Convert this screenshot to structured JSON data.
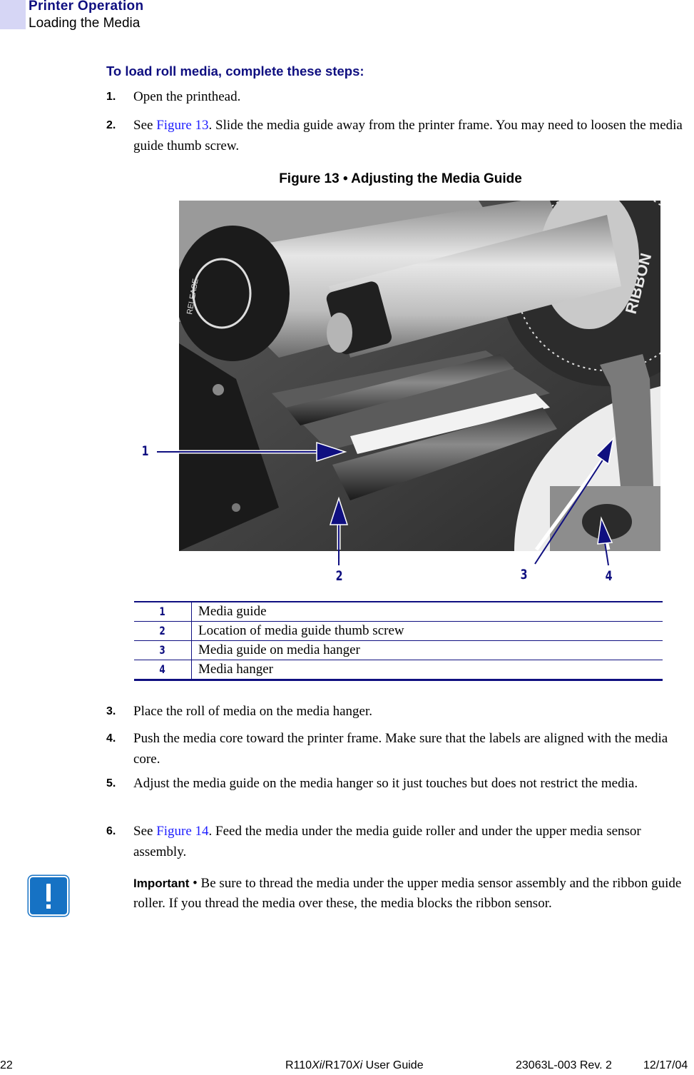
{
  "header": {
    "chapter": "Printer Operation",
    "section": "Loading the Media"
  },
  "procedure": {
    "heading": "To load roll media, complete these steps:",
    "steps": [
      {
        "num": "1.",
        "text": "Open the printhead."
      },
      {
        "num": "2.",
        "pre": "See ",
        "link": "Figure 13",
        "post": ". Slide the media guide away from the printer frame. You may need to loosen the media guide thumb screw."
      },
      {
        "num": "3.",
        "text": "Place the roll of media on the media hanger."
      },
      {
        "num": "4.",
        "text": "Push the media core toward the printer frame. Make sure that the labels are aligned with the media core."
      },
      {
        "num": "5.",
        "text": "Adjust the media guide on the media hanger so it just touches but does not restrict the media."
      },
      {
        "num": "6.",
        "pre": "See ",
        "link": "Figure 14",
        "post": ". Feed the media under the media guide roller and under the upper media sensor assembly."
      }
    ]
  },
  "figure": {
    "caption": "Figure 13 • Adjusting the Media Guide",
    "photo_label": "RIBBON",
    "photo_knob_label": "RELEASE",
    "callouts": [
      "1",
      "2",
      "3",
      "4"
    ],
    "legend": [
      {
        "key": "1",
        "desc": "Media guide"
      },
      {
        "key": "2",
        "desc": "Location of media guide thumb screw"
      },
      {
        "key": "3",
        "desc": "Media guide on media hanger"
      },
      {
        "key": "4",
        "desc": "Media hanger"
      }
    ],
    "callout_color": "#0f0f80"
  },
  "important": {
    "label": "Important",
    "separator": " • ",
    "text": "Be sure to thread the media under the upper media sensor assembly and the ribbon guide roller. If you thread the media over these, the media blocks the ribbon sensor.",
    "icon": "exclamation-icon",
    "icon_color": "#1672c4"
  },
  "footer": {
    "page": "22",
    "guide_a": "R110",
    "guide_a_it": "Xi",
    "guide_sep": "/R170",
    "guide_b_it": "Xi",
    "guide_rest": " User Guide",
    "doc_rev": "23063L-003 Rev. 2",
    "date": "12/17/04"
  }
}
